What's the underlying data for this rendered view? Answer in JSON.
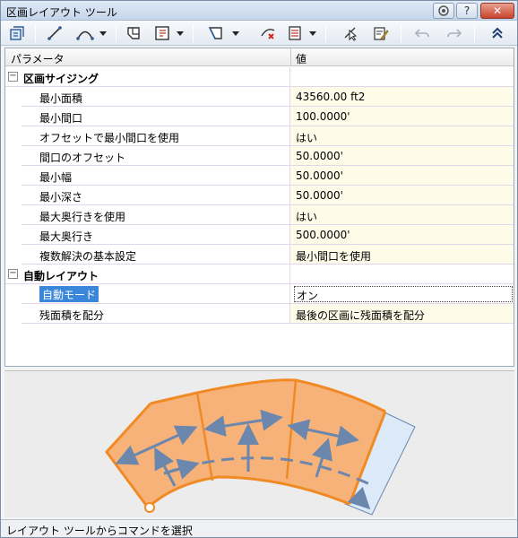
{
  "window": {
    "title": "区画レイアウト ツール",
    "controls": [
      "help",
      "close"
    ]
  },
  "toolbar": {
    "icons": [
      "lot-layout-icon",
      "line-icon",
      "arc-icon",
      "dropdown",
      "polygon-icon",
      "lot-split-icon",
      "dropdown",
      "frontage-icon",
      "dropdown",
      "delete-sublot-icon",
      "lot-table-icon",
      "dropdown",
      "select-lot-icon",
      "edit-lot-icon",
      "undo-icon",
      "redo-icon",
      "collapse-icon"
    ]
  },
  "grid": {
    "col_param": "パラメータ",
    "col_value": "値",
    "groups": [
      {
        "label": "区画サイジング",
        "expander": "−",
        "rows": [
          {
            "name": "最小面積",
            "value": "43560.00 ft2"
          },
          {
            "name": "最小間口",
            "value": "100.0000'"
          },
          {
            "name": "オフセットで最小間口を使用",
            "value": "はい"
          },
          {
            "name": "間口のオフセット",
            "value": "50.0000'"
          },
          {
            "name": "最小幅",
            "value": "50.0000'"
          },
          {
            "name": "最小深さ",
            "value": "50.0000'"
          },
          {
            "name": "最大奥行きを使用",
            "value": "はい"
          },
          {
            "name": "最大奥行き",
            "value": "500.0000'"
          },
          {
            "name": "複数解決の基本設定",
            "value": "最小間口を使用"
          }
        ]
      },
      {
        "label": "自動レイアウト",
        "expander": "−",
        "rows": [
          {
            "name": "自動モード",
            "value": "オン"
          },
          {
            "name": "残面積を配分",
            "value": "最後の区画に残面積を配分"
          }
        ]
      }
    ]
  },
  "preview": {
    "fill_color": "#f7b27a",
    "edge_color": "#f08a24",
    "remainder_color": "#dce9f8",
    "arrow_color": "#6b87ad"
  },
  "status": {
    "text": "レイアウト ツールからコマンドを選択"
  }
}
